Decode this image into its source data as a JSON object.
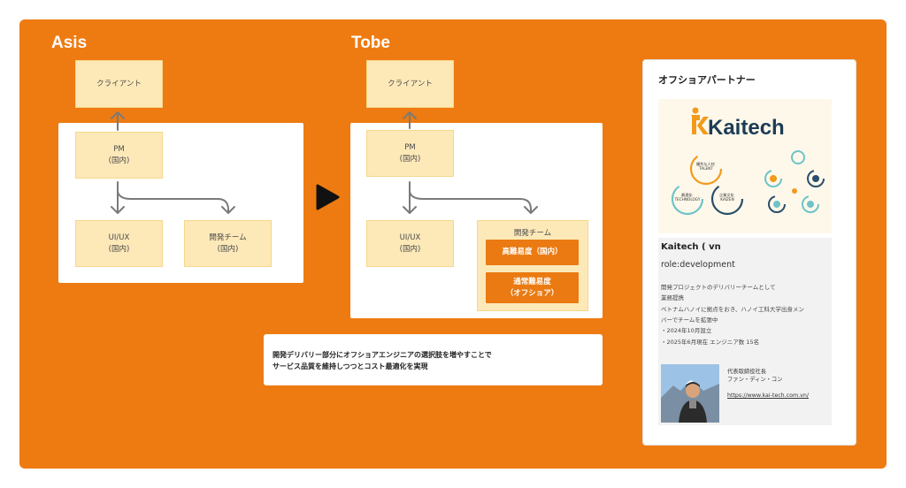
{
  "asis": {
    "title": "Asis",
    "client": "クライアント",
    "pm": "PM\n(国内)",
    "uiux": "UI/UX\n(国内)",
    "dev": "開発チーム\n(国内)"
  },
  "tobe": {
    "title": "Tobe",
    "client": "クライアント",
    "pm": "PM\n(国内)",
    "uiux": "UI/UX\n(国内)",
    "dev_title": "開発チーム",
    "dev_high": "高難易度（国内）",
    "dev_normal": "通常難易度\n（オフショア）"
  },
  "note": {
    "line1": "開発デリバリー部分にオフショアエンジニアの選択肢を増やすことで",
    "line2": "サービス品質を維持しつつとコスト最適化を実現"
  },
  "partner": {
    "heading": "オフショアパートナー",
    "logo_text": "Kaitech",
    "circle_labels": {
      "talent": "優秀な人材\nTALENT",
      "technology": "最適化\nTECHNOLOGY",
      "kaizen": "企業文化\nKAIZEN"
    },
    "company_name": "Kaitech ( vn",
    "role": "role:development",
    "desc_lines": [
      "開発プロジェクトのデリバリーチームとして",
      "業務提携",
      "ベトナムハノイに拠点をおき、ハノイ工科大学出身メン",
      "バーでチームを拡張中",
      "・2024年10月設立",
      "・2025年6月現在 エンジニア数 15名"
    ],
    "ceo_title": "代表取締役社長",
    "ceo_name": "ファン・ディン・コン",
    "url": "https://www.kai-tech.com.vn/"
  },
  "colors": {
    "board": "#ee7b11",
    "box": "#fde9b8",
    "accent_button": "#ea7a11",
    "arrow": "#7a7a7a"
  }
}
